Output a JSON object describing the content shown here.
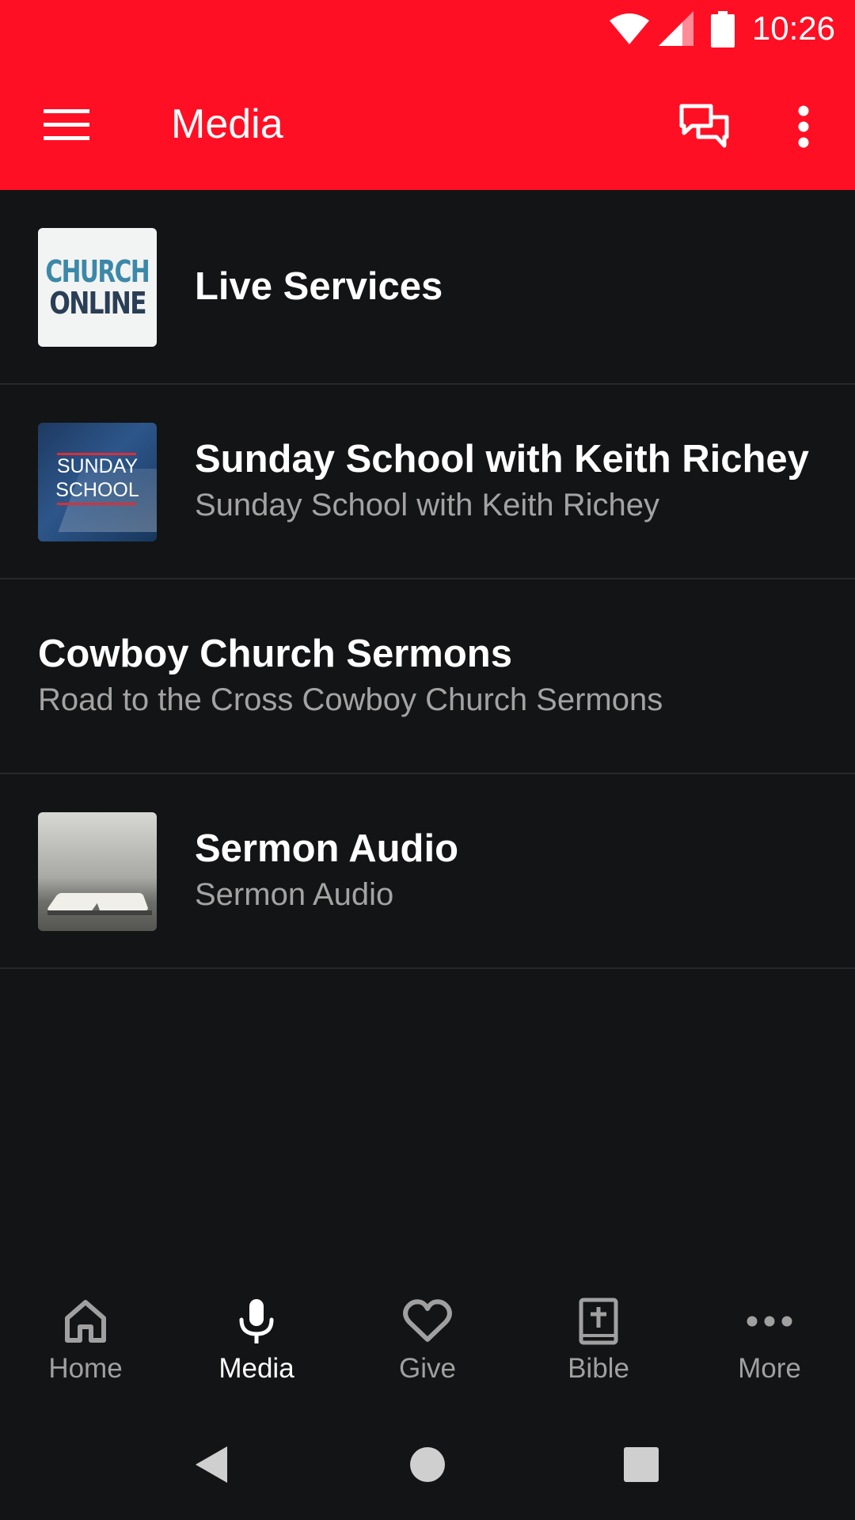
{
  "status_bar": {
    "time": "10:26",
    "icons": [
      "wifi-icon",
      "cell-signal-icon",
      "battery-icon"
    ]
  },
  "app_bar": {
    "title": "Media",
    "actions": [
      "menu-icon",
      "chat-icon",
      "overflow-menu-icon"
    ],
    "background_color": "#ff0f24"
  },
  "media_list": [
    {
      "title": "Live Services",
      "subtitle": "",
      "thumbnail": {
        "line1": "CHURCH",
        "line2": "ONLINE"
      }
    },
    {
      "title": "Sunday School with Keith Richey",
      "subtitle": "Sunday School with Keith Richey",
      "thumbnail": {
        "line1": "SUNDAY",
        "line2": "SCHOOL"
      }
    },
    {
      "title": "Cowboy Church Sermons",
      "subtitle": "Road to the Cross Cowboy Church Sermons"
    },
    {
      "title": "Sermon Audio",
      "subtitle": "Sermon Audio",
      "thumbnail": {
        "icon": "open-bible-photo"
      }
    }
  ],
  "bottom_nav": {
    "items": [
      {
        "label": "Home",
        "icon": "home-icon",
        "active": false
      },
      {
        "label": "Media",
        "icon": "microphone-icon",
        "active": true
      },
      {
        "label": "Give",
        "icon": "heart-icon",
        "active": false
      },
      {
        "label": "Bible",
        "icon": "bible-icon",
        "active": false
      },
      {
        "label": "More",
        "icon": "more-dots-icon",
        "active": false
      }
    ]
  },
  "system_nav": [
    "back-icon",
    "home-circle-icon",
    "recents-square-icon"
  ],
  "colors": {
    "accent": "#ff0f24",
    "background": "#131416",
    "divider": "#26282b",
    "secondary_text": "#a3a3a3"
  }
}
